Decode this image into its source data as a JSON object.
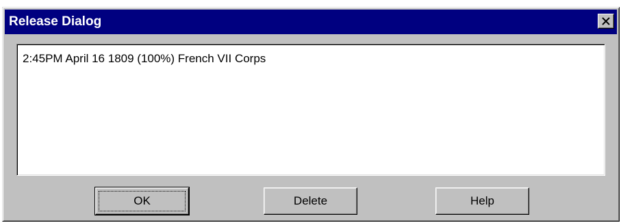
{
  "window": {
    "title": "Release Dialog",
    "close_icon": "close-icon"
  },
  "list": {
    "items": [
      "2:45PM April 16 1809 (100%) French VII Corps"
    ]
  },
  "buttons": {
    "ok_label": "OK",
    "delete_label": "Delete",
    "help_label": "Help"
  },
  "colors": {
    "title_bar": "#000080",
    "dialog_face": "#c0c0c0",
    "list_background": "#ffffff"
  }
}
